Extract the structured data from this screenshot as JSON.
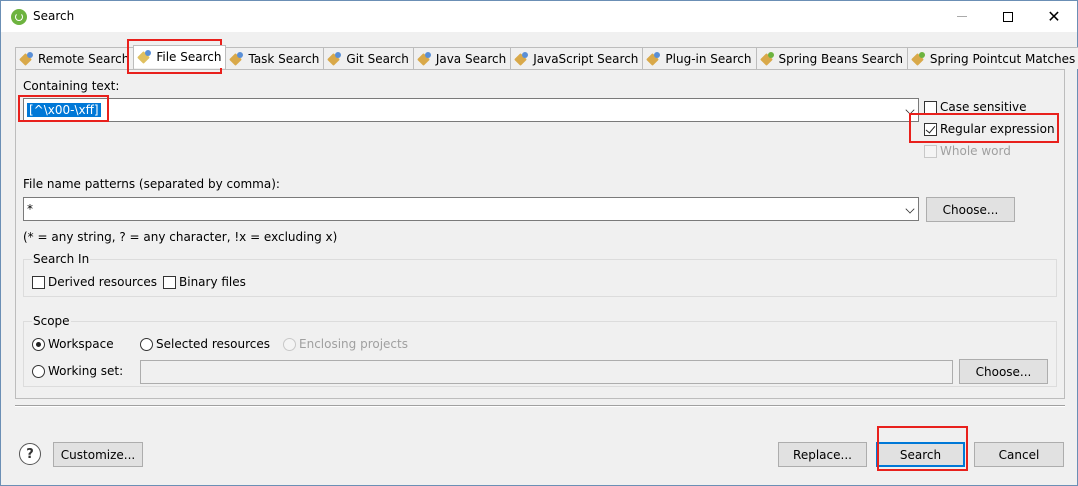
{
  "window": {
    "title": "Search"
  },
  "tabs": [
    {
      "label": "Remote Search"
    },
    {
      "label": "File Search"
    },
    {
      "label": "Task Search"
    },
    {
      "label": "Git Search"
    },
    {
      "label": "Java Search"
    },
    {
      "label": "JavaScript Search"
    },
    {
      "label": "Plug-in Search"
    },
    {
      "label": "Spring Beans Search"
    },
    {
      "label": "Spring Pointcut Matches"
    }
  ],
  "containing_text": {
    "label": "Containing text:",
    "value": "[^\\x00-\\xff]"
  },
  "options": {
    "case_sensitive": {
      "label": "Case sensitive",
      "checked": false
    },
    "regular_expression": {
      "label": "Regular expression",
      "checked": true
    },
    "whole_word": {
      "label": "Whole word",
      "checked": false,
      "enabled": false
    }
  },
  "file_patterns": {
    "label": "File name patterns (separated by comma):",
    "value": "*",
    "choose_label": "Choose...",
    "hint": "(* = any string, ? = any character, !x = excluding x)"
  },
  "search_in": {
    "title": "Search In",
    "derived": {
      "label": "Derived resources",
      "checked": false
    },
    "binary": {
      "label": "Binary files",
      "checked": false
    }
  },
  "scope": {
    "title": "Scope",
    "workspace": {
      "label": "Workspace",
      "selected": true
    },
    "selected_resources": {
      "label": "Selected resources",
      "selected": false
    },
    "enclosing_projects": {
      "label": "Enclosing projects",
      "selected": false,
      "enabled": false
    },
    "working_set": {
      "label": "Working set:",
      "selected": false,
      "value": ""
    },
    "choose_label": "Choose..."
  },
  "footer": {
    "help_symbol": "?",
    "customize_label": "Customize...",
    "replace_label": "Replace...",
    "search_label": "Search",
    "cancel_label": "Cancel"
  },
  "colors": {
    "highlight_box": "#e8201c",
    "selection": "#0078d7",
    "spring_green": "#6db33f"
  }
}
